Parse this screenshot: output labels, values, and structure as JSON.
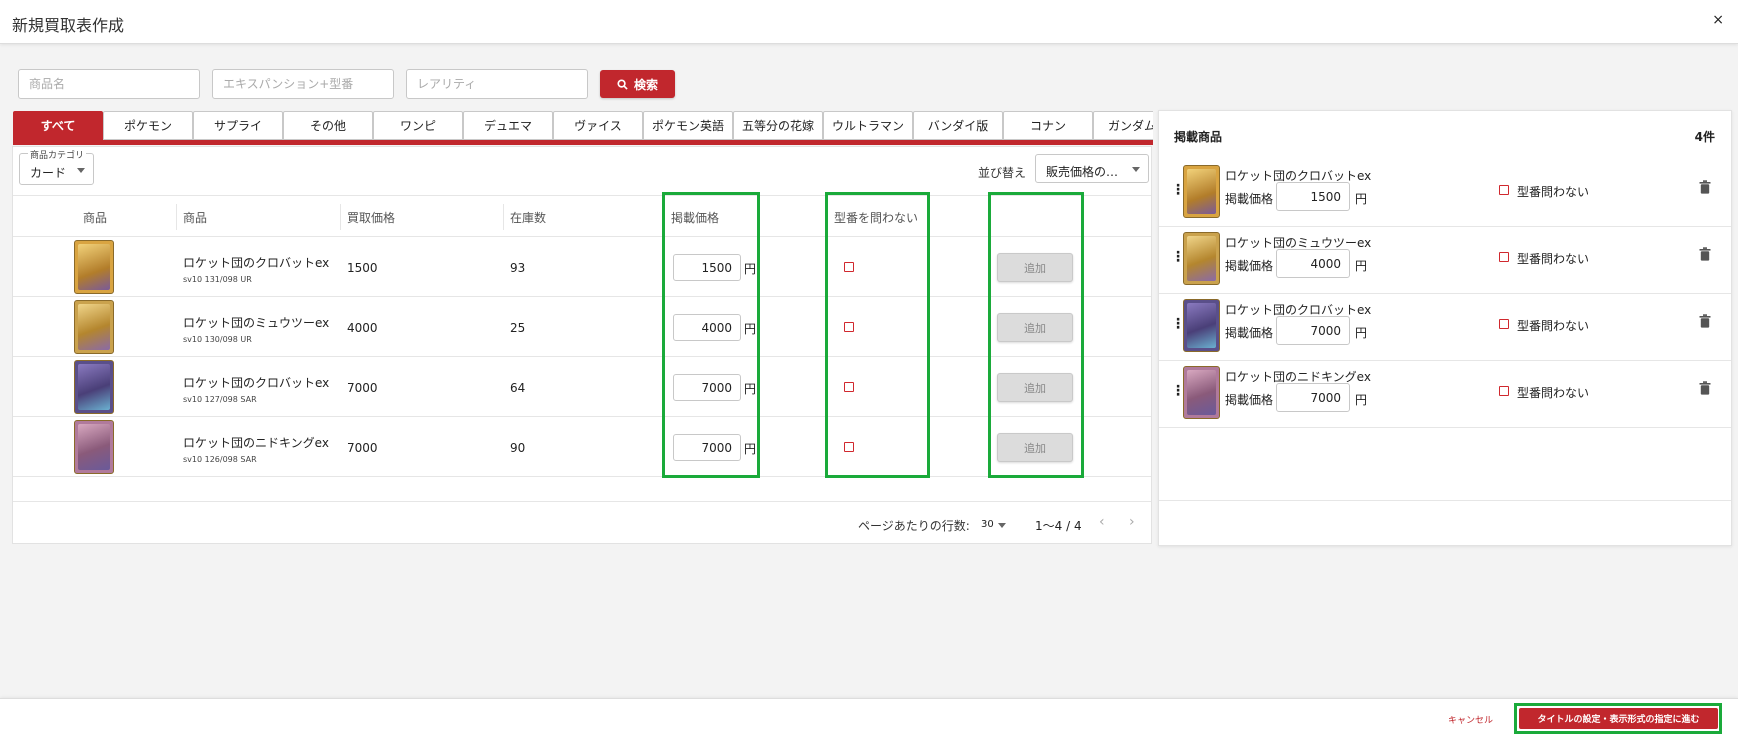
{
  "header": {
    "title": "新規買取表作成",
    "close_icon": "×"
  },
  "search": {
    "product_name_placeholder": "商品名",
    "expansion_placeholder": "エキスパンション+型番",
    "rarity_placeholder": "レアリティ",
    "button_label": "検索"
  },
  "tabs": [
    "すべて",
    "ポケモン",
    "サプライ",
    "その他",
    "ワンピ",
    "デュエマ",
    "ヴァイス",
    "ポケモン英語",
    "五等分の花嫁",
    "ウルトラマン",
    "バンダイ版",
    "コナン",
    "ガンダム"
  ],
  "filters": {
    "category_legend": "商品カテゴリ",
    "category_value": "カード",
    "sort_label": "並び替え",
    "sort_value": "販売価格の…"
  },
  "table": {
    "headers": {
      "image": "商品",
      "name": "商品",
      "buy_price": "買取価格",
      "stock": "在庫数",
      "listed_price": "掲載価格",
      "any_model": "型番を問わない"
    },
    "rows": [
      {
        "name": "ロケット団のクロバットex",
        "code": "sv10 131/098 UR",
        "buy_price": "1500",
        "stock": "93",
        "listed_price": "1500",
        "yen": "円",
        "add_label": "追加"
      },
      {
        "name": "ロケット団のミュウツーex",
        "code": "sv10 130/098 UR",
        "buy_price": "4000",
        "stock": "25",
        "listed_price": "4000",
        "yen": "円",
        "add_label": "追加"
      },
      {
        "name": "ロケット団のクロバットex",
        "code": "sv10 127/098 SAR",
        "buy_price": "7000",
        "stock": "64",
        "listed_price": "7000",
        "yen": "円",
        "add_label": "追加"
      },
      {
        "name": "ロケット団のニドキングex",
        "code": "sv10 126/098 SAR",
        "buy_price": "7000",
        "stock": "90",
        "listed_price": "7000",
        "yen": "円",
        "add_label": "追加"
      }
    ]
  },
  "pagination": {
    "rows_per_page_label": "ページあたりの行数:",
    "rows_per_page_value": "30",
    "range": "1〜4 / 4"
  },
  "right_panel": {
    "title": "掲載商品",
    "count": "4件",
    "price_label": "掲載価格",
    "yen": "円",
    "any_model_label": "型番問わない",
    "items": [
      {
        "name": "ロケット団のクロバットex",
        "price": "1500"
      },
      {
        "name": "ロケット団のミュウツーex",
        "price": "4000"
      },
      {
        "name": "ロケット団のクロバットex",
        "price": "7000"
      },
      {
        "name": "ロケット団のニドキングex",
        "price": "7000"
      }
    ]
  },
  "footer": {
    "cancel_label": "キャンセル",
    "next_label": "タイトルの設定・表示形式の指定に進む"
  },
  "colors": {
    "accent": "#c1272d",
    "highlight": "#1aaa3a",
    "card_1": "#d9a441",
    "card_2": "#caa24d",
    "card_3": "#5a4f8a",
    "card_4": "#b07a9c"
  }
}
